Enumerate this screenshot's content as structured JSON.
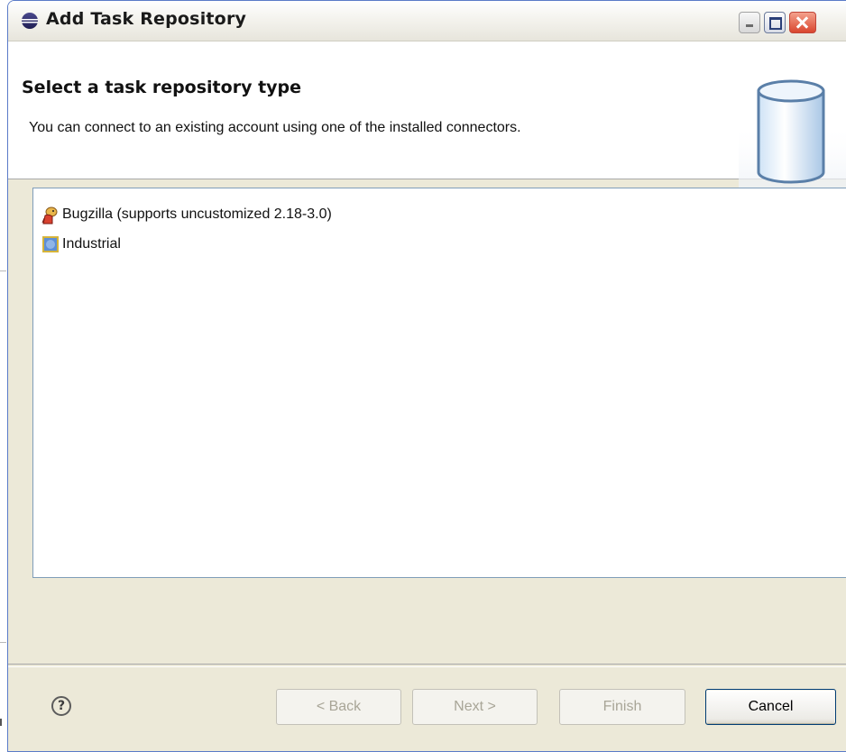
{
  "window": {
    "title": "Add Task Repository",
    "controls": {
      "minimize": "minimize-icon",
      "maximize": "maximize-icon",
      "close": "close-icon"
    }
  },
  "header": {
    "title": "Select a task repository type",
    "description": "You can connect to an existing account using one of the installed connectors.",
    "graphic": "repository-cylinder-icon"
  },
  "connectors": [
    {
      "label": "Bugzilla (supports uncustomized 2.18-3.0)",
      "icon": "bugzilla-icon"
    },
    {
      "label": "Industrial",
      "icon": "industrial-connector-icon"
    }
  ],
  "buttons": {
    "help": "?",
    "back": "< Back",
    "next": "Next >",
    "finish": "Finish",
    "cancel": "Cancel"
  },
  "colors": {
    "dialog_background": "#ece9d8",
    "list_border": "#7f9db9",
    "default_button_border": "#003c74",
    "disabled_text": "#a8a597"
  }
}
